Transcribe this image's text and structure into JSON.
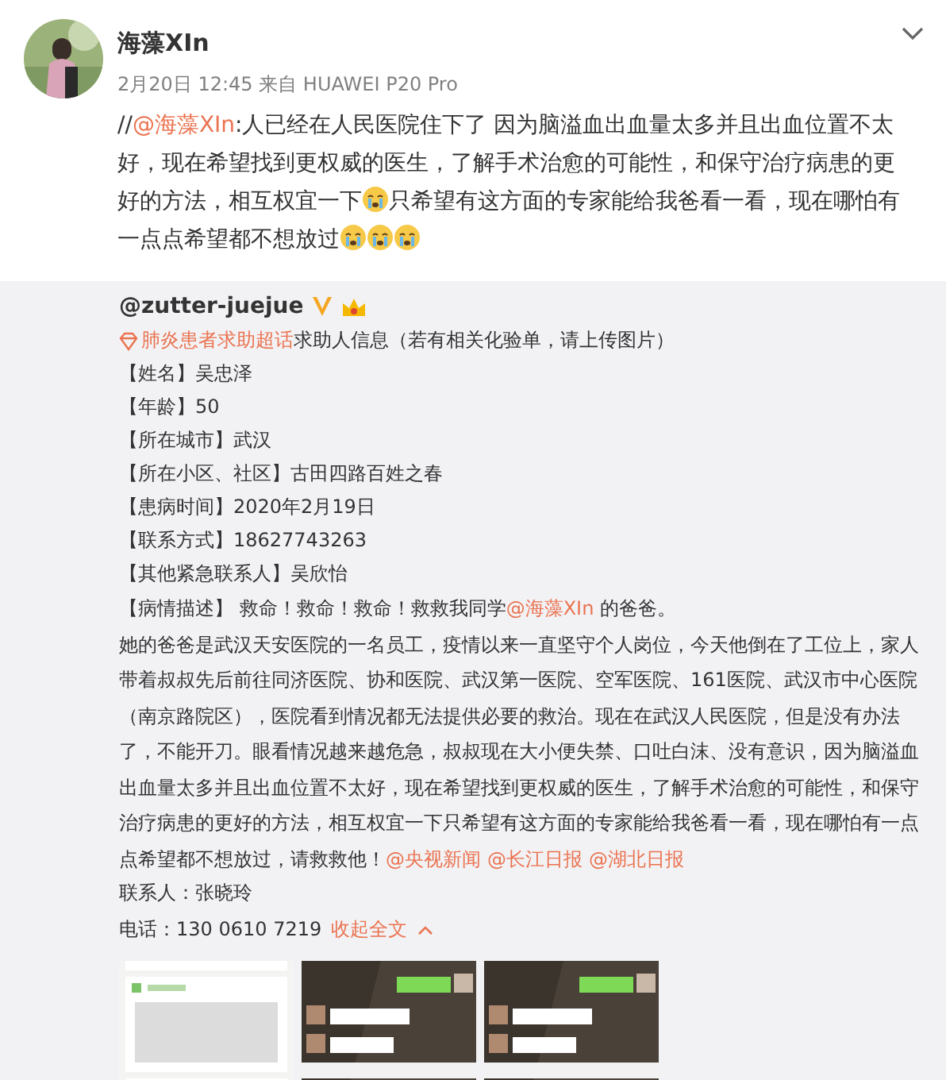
{
  "post": {
    "author": "海藻XIn",
    "avatar": {
      "kind": "picture"
    },
    "meta": "2月20日 12:45 来自 HUAWEI P20 Pro",
    "body": [
      {
        "kind": "text",
        "text": "//"
      },
      {
        "kind": "mention",
        "text": "@海藻XIn"
      },
      {
        "kind": "text",
        "text": ":人已经在人民医院住下了 因为脑溢血出血量太多并且出血位置不太好，现在希望找到更权威的医生，了解手术治愈的可能性，和保守治疗病患的更好的方法，相互权宜一下"
      },
      {
        "kind": "emoji"
      },
      {
        "kind": "text",
        "text": "只希望有这方面的专家能给我爸看一看，现在哪怕有一点点希望都不想放过"
      },
      {
        "kind": "emoji"
      },
      {
        "kind": "emoji"
      },
      {
        "kind": "emoji"
      }
    ]
  },
  "repost": {
    "author": "@zutter-juejue",
    "badges": [
      {
        "kind": "verified"
      },
      {
        "kind": "member"
      }
    ],
    "topic": {
      "link": "肺炎患者求助超话",
      "text": " 求助人信息（若有相关化验单，请上传图片）"
    },
    "fields": [
      "【姓名】吴忠泽",
      "【年龄】50",
      "【所在城市】武汉",
      "【所在小区、社区】古田四路百姓之春",
      "【患病时间】2020年2月19日",
      "【联系方式】18627743263",
      "【其他紧急联系人】吴欣怡"
    ],
    "description": [
      {
        "kind": "text",
        "text": "【病情描述】 救命！救命！救命！救救我同学"
      },
      {
        "kind": "mention",
        "text": "@海藻XIn"
      },
      {
        "kind": "text",
        "text": " 的爸爸。"
      }
    ],
    "story": [
      {
        "kind": "text",
        "text": "她的爸爸是武汉天安医院的一名员工，疫情以来一直坚守个人岗位，今天他倒在了工位上，家人带着叔叔先后前往同济医院、协和医院、武汉第一医院、空军医院、161医院、武汉市中心医院（南京路院区），医院看到情况都无法提供必要的救治。现在在武汉人民医院，但是没有办法了，不能开刀。眼看情况越来越危急，叔叔现在大小便失禁、口吐白沫、没有意识，因为脑溢血出血量太多并且出血位置不太好，现在希望找到更权威的医生，了解手术治愈的可能性，和保守治疗病患的更好的方法，相互权宜一下只希望有这方面的专家能给我爸看一看，现在哪怕有一点点希望都不想放过，请救救他！"
      },
      {
        "kind": "mention",
        "text": "@央视新闻"
      },
      {
        "kind": "mention",
        "text": "@长江日报"
      },
      {
        "kind": "mention",
        "text": "@湖北日报"
      }
    ],
    "contact": "联系人：张晓玲",
    "phone": "电话：130 0610 7219",
    "collapse_link": "收起全文",
    "images": [
      {
        "kind": "picture"
      },
      {
        "kind": "picture"
      },
      {
        "kind": "picture"
      }
    ]
  }
}
